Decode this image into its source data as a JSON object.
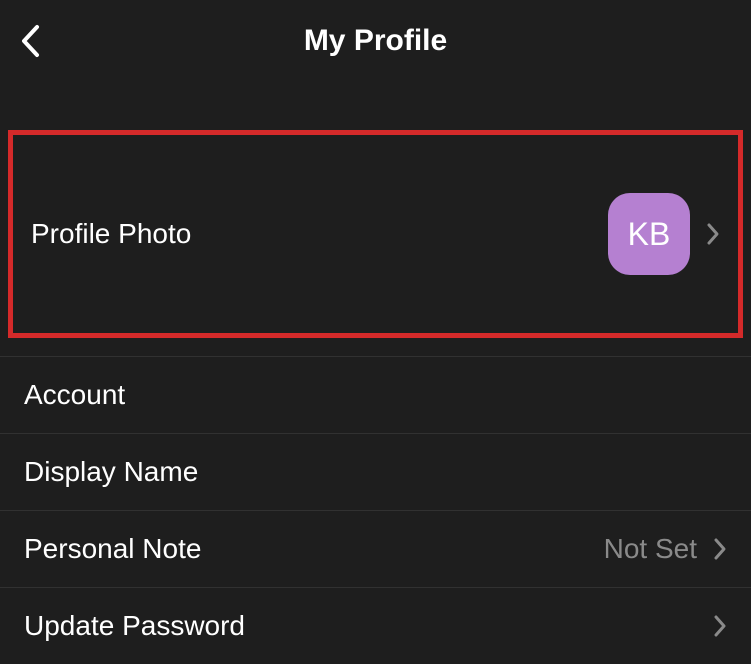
{
  "header": {
    "title": "My Profile"
  },
  "menu": {
    "profile_photo": {
      "label": "Profile Photo",
      "avatar_initials": "KB"
    },
    "account": {
      "label": "Account"
    },
    "display_name": {
      "label": "Display Name"
    },
    "personal_note": {
      "label": "Personal Note",
      "value": "Not Set"
    },
    "update_password": {
      "label": "Update Password"
    }
  },
  "colors": {
    "background": "#1e1e1e",
    "avatar": "#b580d1",
    "highlight_border": "#d42a2a"
  }
}
